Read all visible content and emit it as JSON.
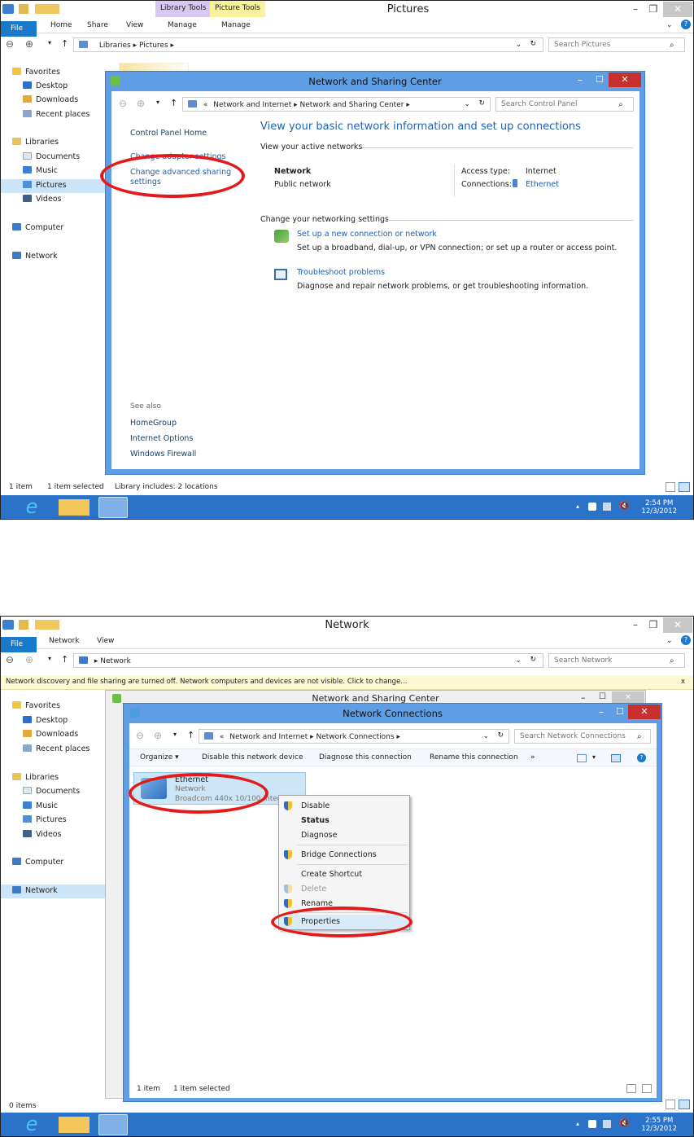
{
  "shot1": {
    "ribbon_context": {
      "library_tools": "Library Tools",
      "picture_tools": "Picture Tools"
    },
    "window_title": "Pictures",
    "tabs": [
      "File",
      "Home",
      "Share",
      "View",
      "Manage",
      "Manage"
    ],
    "breadcrumb": [
      "Libraries",
      "Pictures"
    ],
    "search_placeholder": "Search Pictures",
    "nav": {
      "favorites": "Favorites",
      "desktop": "Desktop",
      "downloads": "Downloads",
      "recent": "Recent places",
      "libraries": "Libraries",
      "documents": "Documents",
      "music": "Music",
      "pictures": "Pictures",
      "videos": "Videos",
      "computer": "Computer",
      "network": "Network"
    },
    "status": {
      "count": "1 item",
      "selected": "1 item selected",
      "library": "Library includes: 2 locations"
    },
    "clock": {
      "time": "2:54 PM",
      "date": "12/3/2012"
    },
    "nsc": {
      "title": "Network and Sharing Center",
      "breadcrumb": [
        "«",
        "Network and Internet",
        "Network and Sharing Center"
      ],
      "search_placeholder": "Search Control Panel",
      "left": {
        "home": "Control Panel Home",
        "change_adapter": "Change adapter settings",
        "change_sharing_1": "Change advanced sharing",
        "change_sharing_2": "settings",
        "see_also": "See also",
        "homegroup": "HomeGroup",
        "internet_options": "Internet Options",
        "firewall": "Windows Firewall"
      },
      "heading": "View your basic network information and set up connections",
      "active_networks": "View your active networks",
      "network_name": "Network",
      "network_type": "Public network",
      "access_type_label": "Access type:",
      "access_type_value": "Internet",
      "connections_label": "Connections:",
      "connections_value": "Ethernet",
      "change_settings": "Change your networking settings",
      "setup_link": "Set up a new connection or network",
      "setup_desc": "Set up a broadband, dial-up, or VPN connection; or set up a router or access point.",
      "troubleshoot_link": "Troubleshoot problems",
      "troubleshoot_desc": "Diagnose and repair network problems, or get troubleshooting information."
    }
  },
  "shot2": {
    "window_title": "Network",
    "tabs": [
      "File",
      "Network",
      "View"
    ],
    "breadcrumb": [
      "Network"
    ],
    "search_placeholder": "Search Network",
    "infobar": "Network discovery and file sharing are turned off. Network computers and devices are not visible. Click to change...",
    "infobar_close": "x",
    "nav": {
      "favorites": "Favorites",
      "desktop": "Desktop",
      "downloads": "Downloads",
      "recent": "Recent places",
      "libraries": "Libraries",
      "documents": "Documents",
      "music": "Music",
      "pictures": "Pictures",
      "videos": "Videos",
      "computer": "Computer",
      "network": "Network"
    },
    "status": {
      "count": "0 items"
    },
    "clock": {
      "time": "2:55 PM",
      "date": "12/3/2012"
    },
    "behind_title": "Network and Sharing Center",
    "nc": {
      "title": "Network Connections",
      "breadcrumb": [
        "«",
        "Network and Internet",
        "Network Connections"
      ],
      "search_placeholder": "Search Network Connections",
      "toolbar": [
        "Organize ▾",
        "Disable this network device",
        "Diagnose this connection",
        "Rename this connection",
        "»"
      ],
      "adapter": {
        "name": "Ethernet",
        "status": "Network",
        "device": "Broadcom 440x 10/100 Integ..."
      },
      "status": {
        "count": "1 item",
        "selected": "1 item selected"
      },
      "menu": [
        "Disable",
        "Status",
        "Diagnose",
        "Bridge Connections",
        "Create Shortcut",
        "Delete",
        "Rename",
        "Properties"
      ]
    }
  },
  "colors": {
    "accent": "#1979ca",
    "taskbar": "#2a73c9",
    "overlay_frame": "#5f9ee4",
    "highlight_ring": "#e41a1a"
  }
}
